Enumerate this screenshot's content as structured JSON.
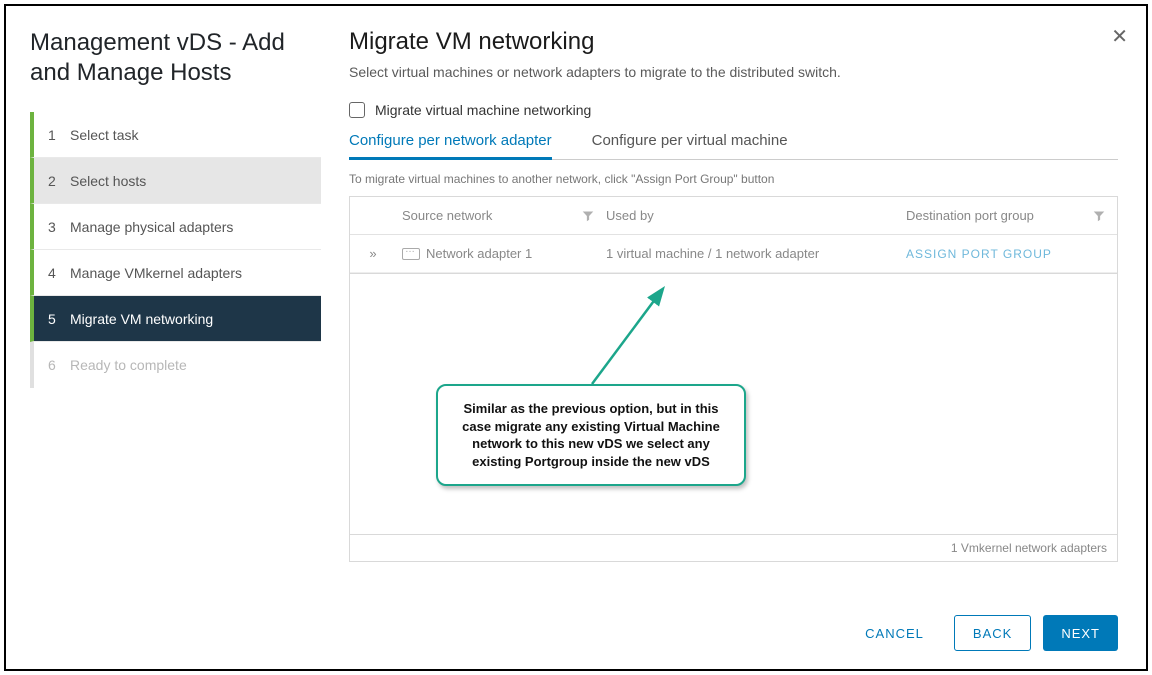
{
  "sidebar": {
    "title": "Management vDS - Add and Manage Hosts",
    "steps": [
      {
        "num": "1",
        "label": "Select task"
      },
      {
        "num": "2",
        "label": "Select hosts"
      },
      {
        "num": "3",
        "label": "Manage physical adapters"
      },
      {
        "num": "4",
        "label": "Manage VMkernel adapters"
      },
      {
        "num": "5",
        "label": "Migrate VM networking"
      },
      {
        "num": "6",
        "label": "Ready to complete"
      }
    ]
  },
  "main": {
    "title": "Migrate VM networking",
    "subtitle": "Select virtual machines or network adapters to migrate to the distributed switch.",
    "checkbox_label": "Migrate virtual machine networking",
    "tabs": [
      {
        "label": "Configure per network adapter"
      },
      {
        "label": "Configure per virtual machine"
      }
    ],
    "hint_text": "To migrate virtual machines to another network, click \"Assign Port Group\" button",
    "columns": {
      "source": "Source network",
      "usedby": "Used by",
      "dest": "Destination port group"
    },
    "row": {
      "adapter": "Network adapter 1",
      "usedby": "1 virtual machine / 1 network adapter",
      "assign": "ASSIGN PORT GROUP"
    },
    "footer_text": "1 Vmkernel network adapters"
  },
  "buttons": {
    "cancel": "CANCEL",
    "back": "BACK",
    "next": "NEXT"
  },
  "annotation": {
    "text": "Similar as the previous option, but in this case migrate any existing Virtual Machine network to this new vDS we select any existing Portgroup inside the new vDS"
  }
}
